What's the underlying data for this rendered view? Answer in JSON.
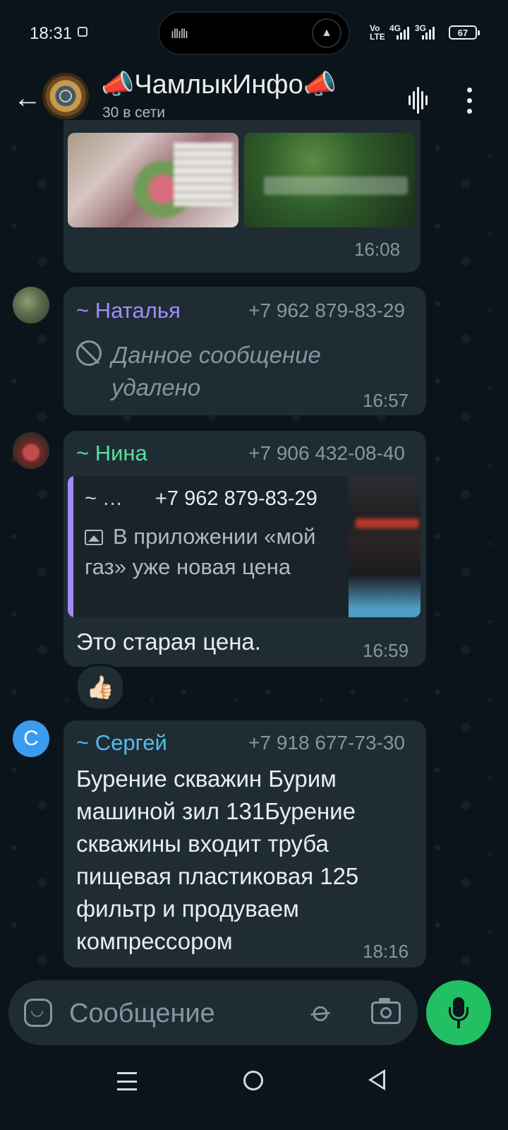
{
  "status_bar": {
    "time": "18:31",
    "network_1": "Vo LTE",
    "network_2": "4G",
    "network_3": "3G",
    "battery": "67"
  },
  "header": {
    "title": "📣ЧамлыкИнфо📣",
    "subtitle": "30 в сети"
  },
  "messages": {
    "media_time": "16:08",
    "natalya": {
      "name": "~ Наталья",
      "phone": "+7 962 879-83-29",
      "text": "Данное сообщение удалено",
      "time": "16:57",
      "name_color": "#a38bfa"
    },
    "nina": {
      "name": "~ Нина",
      "phone": "+7 906 432-08-40",
      "quote_name": "~ …",
      "quote_phone": "+7 962 879-83-29",
      "quote_text": "В приложении «мой газ» уже новая цена",
      "text": "Это старая цена.",
      "time": "16:59",
      "reaction": "👍🏻",
      "name_color": "#53bdeb"
    },
    "sergey": {
      "avatar_letter": "С",
      "name": "~ Сергей",
      "phone": "+7 918 677-73-30",
      "text": "Бурение скважин Бурим машиной зил 131Бурение скважины входит труба пищевая пластиковая 125 фильтр и продуваем компрессором",
      "time": "18:16",
      "name_color": "#53bdeb"
    }
  },
  "input": {
    "placeholder": "Сообщение"
  },
  "colors": {
    "background": "#0b141a",
    "bubble": "#202c33",
    "accent": "#21c063",
    "nina_name": "#53e0a0",
    "sergey_avatar": "#3b9bef"
  }
}
